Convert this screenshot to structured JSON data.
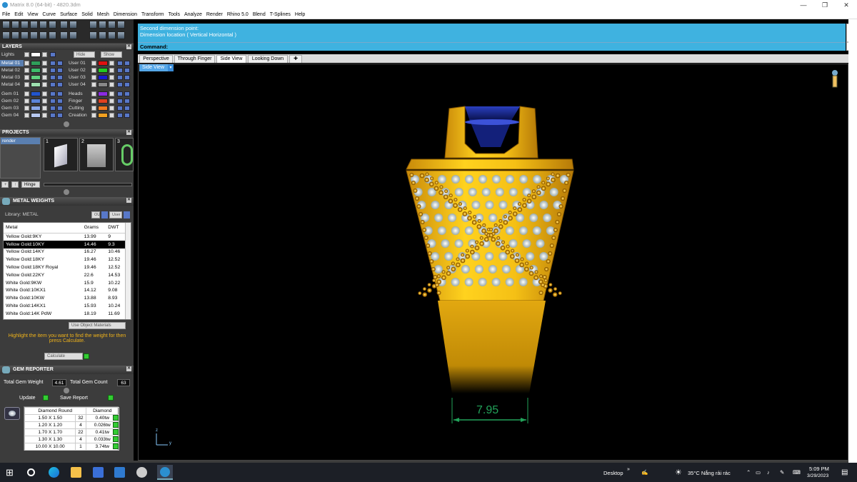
{
  "window": {
    "title": "Matrix 8.0 (64-bit) - 4820.3dm"
  },
  "menu": [
    "File",
    "Edit",
    "View",
    "Curve",
    "Surface",
    "Solid",
    "Mesh",
    "Dimension",
    "Transform",
    "Tools",
    "Analyze",
    "Render",
    "Rhino 5.0",
    "Blend",
    "T-Splines",
    "Help"
  ],
  "layers": {
    "title": "LAYERS",
    "lights_label": "Lights",
    "hide_label": "Hide",
    "show_label": "Show",
    "left_col": [
      {
        "name": "Metal 01",
        "color": "#2f9e5a",
        "selected": true
      },
      {
        "name": "Metal 02",
        "color": "#3dbb6b",
        "selected": false
      },
      {
        "name": "Metal 03",
        "color": "#5fd07f",
        "selected": false
      },
      {
        "name": "Metal 04",
        "color": "#9ee0b0",
        "selected": false
      },
      {
        "name": "Gem 01",
        "color": "#2255cc",
        "selected": false
      },
      {
        "name": "Gem 02",
        "color": "#5b84d8",
        "selected": false
      },
      {
        "name": "Gem 03",
        "color": "#8aa8e8",
        "selected": false
      },
      {
        "name": "Gem 04",
        "color": "#b7c8f0",
        "selected": false
      }
    ],
    "right_col": [
      {
        "name": "User 01",
        "color": "#e01010"
      },
      {
        "name": "User 02",
        "color": "#22cc22"
      },
      {
        "name": "User 03",
        "color": "#1a1ad0"
      },
      {
        "name": "User 04",
        "color": "#888888"
      },
      {
        "name": "Heads",
        "color": "#8a2be2"
      },
      {
        "name": "Finger",
        "color": "#e04020"
      },
      {
        "name": "Cutting",
        "color": "#f07820"
      },
      {
        "name": "Creation",
        "color": "#f0a020"
      }
    ]
  },
  "projects": {
    "title": "PROJECTS",
    "selected": "render",
    "thumbs": [
      "1",
      "2",
      "3"
    ],
    "hinge_label": "Hinge"
  },
  "metal_weights": {
    "title": "METAL WEIGHTS",
    "library": "Library: METAL",
    "ou_label": "OU",
    "user_label": "User",
    "columns": [
      "Metal",
      "Grams",
      "DWT"
    ],
    "rows": [
      [
        "Yellow Gold:9KY",
        "13.99",
        "9"
      ],
      [
        "Yellow Gold:10KY",
        "14.46",
        "9.3"
      ],
      [
        "Yellow Gold:14KY",
        "16.27",
        "10.46"
      ],
      [
        "Yellow Gold:18KY",
        "19.46",
        "12.52"
      ],
      [
        "Yellow Gold:18KY Royal",
        "19.46",
        "12.52"
      ],
      [
        "Yellow Gold:22KY",
        "22.6",
        "14.53"
      ],
      [
        "White Gold:9KW",
        "15.9",
        "10.22"
      ],
      [
        "White Gold:10KX1",
        "14.12",
        "9.08"
      ],
      [
        "White Gold:10KW",
        "13.88",
        "8.93"
      ],
      [
        "White Gold:14KX1",
        "15.93",
        "10.24"
      ],
      [
        "White Gold:14K PdW",
        "18.19",
        "11.69"
      ]
    ],
    "selected_row": 1,
    "use_object_materials": "Use Object Materials",
    "instructions": "Highlight the item you want to find the weight for then press Calculate.",
    "calculate_label": "Calculate"
  },
  "gem_reporter": {
    "title": "GEM REPORTER",
    "total_gem_weight_label": "Total Gem Weight",
    "total_gem_weight": "4.61",
    "total_gem_count_label": "Total Gem Count",
    "total_gem_count": "63",
    "update_label": "Update",
    "save_report_label": "Save Report",
    "headers": [
      "Diamond Round",
      "Diamond"
    ],
    "rows": [
      [
        "1.50 X 1.50",
        "32",
        "0.40tw"
      ],
      [
        "1.20 X 1.20",
        "4",
        "0.026tw"
      ],
      [
        "1.70 X 1.70",
        "22",
        "0.41tw"
      ],
      [
        "1.30 X 1.30",
        "4",
        "0.033tw"
      ],
      [
        "10.00 X 10.00",
        "1",
        "3.74tw"
      ]
    ]
  },
  "command": {
    "history": [
      "Second dimension point:",
      "Dimension location ( Vertical  Horizontal )"
    ],
    "label": "Command:"
  },
  "view_tabs": [
    "Perspective",
    "Through Finger",
    "Side View",
    "Looking Down"
  ],
  "active_view": "Side View",
  "viewport_label": "Side View",
  "dimension_value": "7.95",
  "axis": {
    "z": "z",
    "y": "y"
  },
  "taskbar": {
    "desktop_label": "Desktop",
    "weather": "35°C  Nắng rải rác",
    "time": "5:09 PM",
    "date": "3/29/2023",
    "colors": {
      "bg": "#1c1f26"
    }
  },
  "colors": {
    "accent": "#3fb2e0",
    "panel": "#3c3c3c",
    "gold": "#f0b31a",
    "dimension": "#22a35a",
    "gem": "#1d2f9e"
  }
}
